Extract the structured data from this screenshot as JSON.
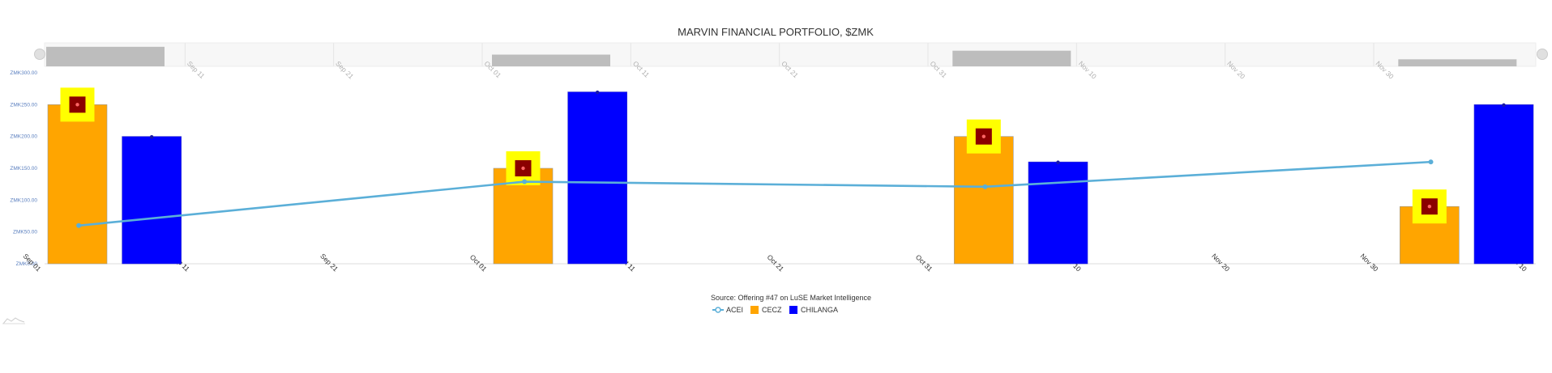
{
  "chart_data": {
    "type": "bar",
    "title": "MARVIN FINANCIAL PORTFOLIO, $ZMK",
    "source": "Source: Offering #47 on LuSE Market Intelligence",
    "y_tick_labels": [
      "ZMK0.00",
      "ZMK50.00",
      "ZMK100.00",
      "ZMK150.00",
      "ZMK200.00",
      "ZMK250.00",
      "ZMK300.00"
    ],
    "x_tick_labels": [
      "Sep 01",
      "Sep 11",
      "Sep 21",
      "Oct 01",
      "Oct 11",
      "Oct 21",
      "Oct 31",
      "Nov 10",
      "Nov 20",
      "Nov 30",
      "Dec 10"
    ],
    "navigator_tick_labels": [
      "Sep 11",
      "Sep 21",
      "Oct 01",
      "Oct 11",
      "Oct 21",
      "Oct 31",
      "Nov 10",
      "Nov 20",
      "Nov 30"
    ],
    "x_range": [
      "2015-09-01",
      "2015-12-12"
    ],
    "ylim": [
      0,
      300
    ],
    "legend": {
      "placement": "bottom-center"
    },
    "series": [
      {
        "name": "ACEI",
        "kind": "line",
        "color": "#5bafd8",
        "points": [
          {
            "x": "2015-09-06",
            "y": 60
          },
          {
            "x": "2015-10-06",
            "y": 129
          },
          {
            "x": "2015-11-06",
            "y": 121
          },
          {
            "x": "2015-12-06",
            "y": 160
          }
        ]
      },
      {
        "name": "CECZ",
        "kind": "bar",
        "color": "#ffa500",
        "points": [
          {
            "x": "2015-09-01",
            "y": 250
          },
          {
            "x": "2015-10-01",
            "y": 150
          },
          {
            "x": "2015-11-01",
            "y": 200
          },
          {
            "x": "2015-12-01",
            "y": 90
          }
        ]
      },
      {
        "name": "CHILANGA",
        "kind": "bar",
        "color": "#0000ff",
        "points": [
          {
            "x": "2015-09-06",
            "y": 200
          },
          {
            "x": "2015-10-06",
            "y": 270
          },
          {
            "x": "2015-11-06",
            "y": 160
          },
          {
            "x": "2015-12-06",
            "y": 250
          }
        ]
      }
    ],
    "marker_colors": {
      "outer": "#ffff00",
      "inner": "#8b0000",
      "dot": "#ff6666"
    },
    "navigator_bar_color": "#bdbdbd"
  }
}
